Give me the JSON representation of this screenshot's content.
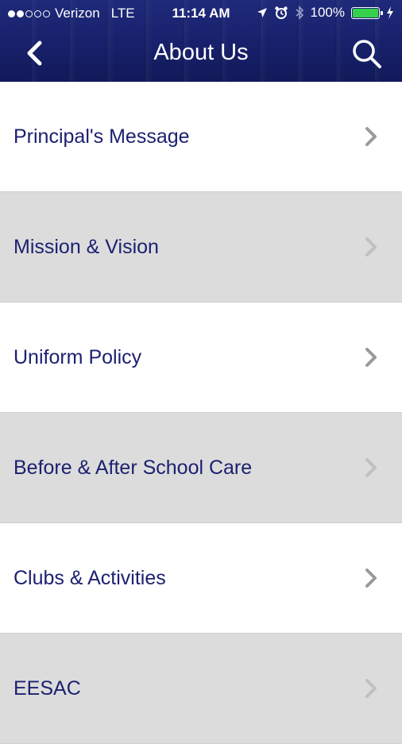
{
  "status_bar": {
    "carrier": "Verizon",
    "network": "LTE",
    "time": "11:14 AM",
    "battery": "100%",
    "signal_bars_filled": 2,
    "signal_bars_total": 5
  },
  "nav": {
    "title": "About Us",
    "back_icon": "chevron-left-icon",
    "search_icon": "search-icon"
  },
  "colors": {
    "header": "#17206a",
    "label_text": "#1c2170",
    "alt_row": "#dcdcdc",
    "battery_fill": "#35d14a"
  },
  "menu": {
    "items": [
      {
        "label": "Principal's Message"
      },
      {
        "label": "Mission & Vision"
      },
      {
        "label": "Uniform Policy"
      },
      {
        "label": "Before & After School Care"
      },
      {
        "label": "Clubs & Activities"
      },
      {
        "label": "EESAC"
      }
    ]
  }
}
